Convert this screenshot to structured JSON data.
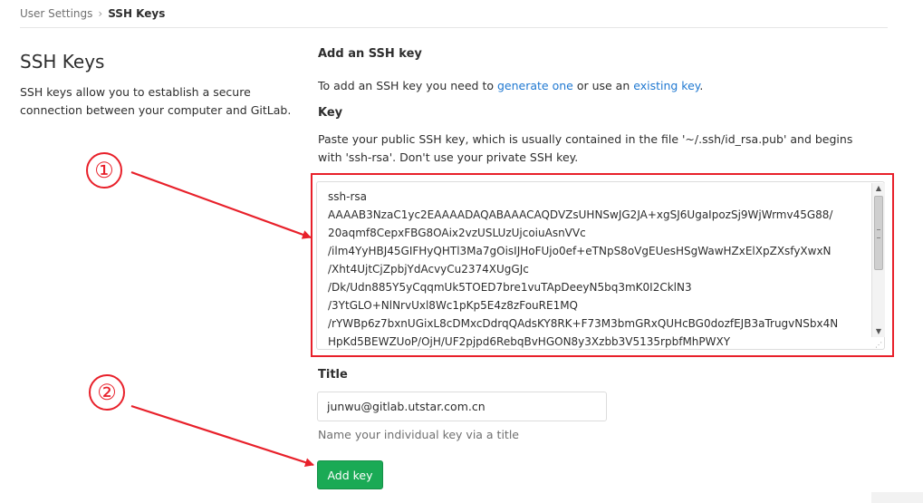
{
  "breadcrumb": {
    "parent": "User Settings",
    "separator": "›",
    "current": "SSH Keys"
  },
  "left": {
    "title": "SSH Keys",
    "description": "SSH keys allow you to establish a secure connection between your computer and GitLab."
  },
  "form": {
    "heading": "Add an SSH key",
    "intro_prefix": "To add an SSH key you need to ",
    "generate_link": "generate one",
    "intro_middle": " or use an ",
    "existing_link": "existing key",
    "intro_suffix": ".",
    "key_label": "Key",
    "key_help": "Paste your public SSH key, which is usually contained in the file '~/.ssh/id_rsa.pub' and begins with 'ssh-rsa'. Don't use your private SSH key.",
    "key_lines": [
      "ssh-rsa",
      "AAAAB3NzaC1yc2EAAAADAQABAAACAQDVZsUHNSwJG2JA+xgSJ6UgaIpozSj9WjWrmv45G88/",
      "20aqmf8CepxFBG8OAix2vzUSLUzUjcoiuAsnVVc",
      "/ilm4YyHBJ45GIFHyQHTl3Ma7gOisIJHoFUjo0ef+eTNpS8oVgEUesHSgWawHZxElXpZXsfyXwxN",
      "/Xht4UjtCjZpbjYdAcvyCu2374XUgGJc",
      "/Dk/Udn885Y5yCqqmUk5TOED7bre1vuTApDeeyN5bq3mK0I2CklN3",
      "/3YtGLO+NlNrvUxl8Wc1pKp5E4z8zFouRE1MQ",
      "/rYWBp6z7bxnUGixL8cDMxcDdrqQAdsKY8RK+F73M3bmGRxQUHcBG0dozfEJB3aTrugvNSbx4N",
      "HpKd5BEWZUoP/OjH/UF2pjpd6RebqBvHGON8y3Xzbb3V5135rpbfMhPWXY"
    ],
    "title_label": "Title",
    "title_value": "junwu@gitlab.utstar.com.cn",
    "title_help": "Name your individual key via a title",
    "submit_label": "Add key"
  },
  "annotations": {
    "step1": "①",
    "step2": "②",
    "color": "#e8202a"
  },
  "colors": {
    "link": "#1f78d1",
    "button": "#1aaa55"
  }
}
